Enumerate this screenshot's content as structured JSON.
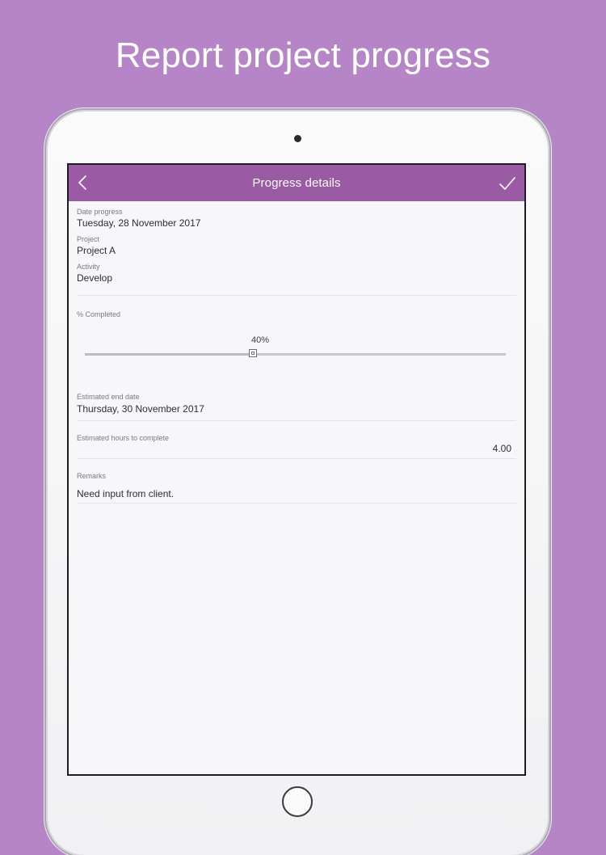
{
  "headline": "Report project progress",
  "navbar": {
    "title": "Progress details",
    "back_icon": "chevron-left-icon",
    "confirm_icon": "checkmark-icon"
  },
  "fields": {
    "date_progress": {
      "label": "Date progress",
      "value": "Tuesday, 28 November 2017"
    },
    "project": {
      "label": "Project",
      "value": "Project A"
    },
    "activity": {
      "label": "Activity",
      "value": "Develop"
    },
    "percent_completed": {
      "label": "% Completed",
      "display": "40%",
      "value": 40
    },
    "estimated_end_date": {
      "label": "Estimated end date",
      "value": "Thursday, 30 November 2017"
    },
    "estimated_hours": {
      "label": "Estimated hours to complete",
      "value": "4.00"
    },
    "remarks": {
      "label": "Remarks",
      "value": "Need input from client."
    }
  },
  "colors": {
    "background": "#b585c8",
    "navbar": "#9a5aa4",
    "screen": "#f7f7f9"
  }
}
